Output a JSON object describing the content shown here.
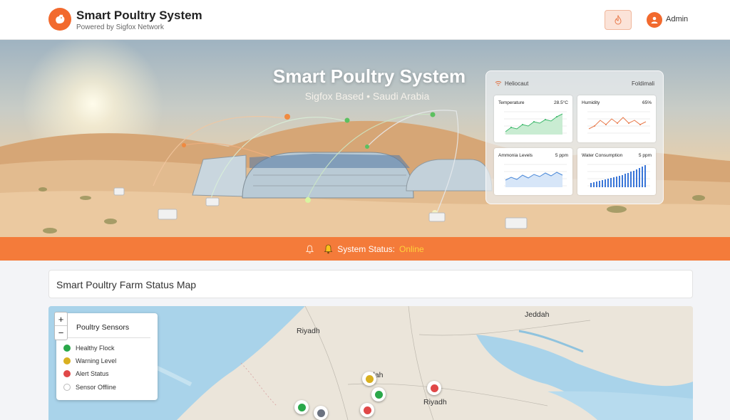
{
  "header": {
    "title": "Smart Poultry System",
    "subtitle": "Powered by Sigfox Network",
    "user": "Admin",
    "logo_icon": "chicken-icon",
    "alert_icon": "flame-icon"
  },
  "hero": {
    "title": "Smart Poultry System",
    "subtitle": "Sigfox Based • Saudi Arabia",
    "panel": {
      "left_label": "Heliocaut",
      "right_label": "Foldimali",
      "cards": [
        {
          "label": "Temperature",
          "value": "28.5°C",
          "color": "#3cb86a"
        },
        {
          "label": "Humidity",
          "value": "65%",
          "color": "#e8794a"
        },
        {
          "label": "Ammonia Levels",
          "value": "5 ppm",
          "color": "#4a88d8"
        },
        {
          "label": "Water Consumption",
          "value": "5 ppm",
          "color": "#3a76d8"
        }
      ]
    }
  },
  "status": {
    "label": "System Status:",
    "value": "Online",
    "icon": "bell-icon"
  },
  "map_section": {
    "title": "Smart Poultry Farm Status Map",
    "zoom_in": "+",
    "zoom_out": "−",
    "legend": {
      "title": "Poultry Sensors",
      "items": [
        {
          "label": "Healthy Flock",
          "color": "#2aa84a"
        },
        {
          "label": "Warning Level",
          "color": "#d9b020"
        },
        {
          "label": "Alert Status",
          "color": "#e04848"
        },
        {
          "label": "Sensor Offline",
          "color": "#ffffff"
        }
      ]
    },
    "labels": {
      "jeddah": "Jeddah",
      "riyadh_top": "Riyadh",
      "riyadh_bottom": "Riyadh",
      "dah": "dah"
    }
  },
  "colors": {
    "accent": "#f26a2e",
    "status_bar": "#f47b3a",
    "online": "#ffd23a"
  }
}
